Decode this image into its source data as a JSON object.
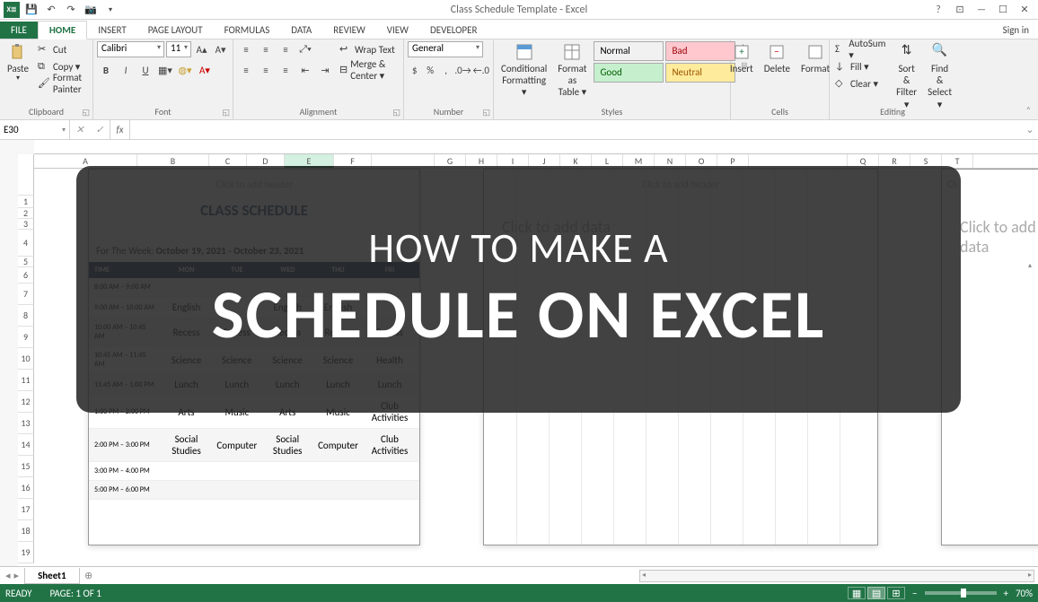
{
  "title": "Class Schedule Template - Excel",
  "qat": {
    "app_icon": "X≣"
  },
  "tabs": [
    "FILE",
    "HOME",
    "INSERT",
    "PAGE LAYOUT",
    "FORMULAS",
    "DATA",
    "REVIEW",
    "VIEW",
    "DEVELOPER"
  ],
  "signin": "Sign in",
  "clipboard": {
    "label": "Clipboard",
    "paste": "Paste",
    "cut": "Cut",
    "copy": "Copy ▾",
    "painter": "Format Painter"
  },
  "font": {
    "label": "Font",
    "name": "Calibri",
    "size": "11",
    "bold": "B",
    "italic": "I",
    "underline": "U"
  },
  "alignment": {
    "label": "Alignment",
    "wrap": "Wrap Text",
    "merge": "Merge & Center ▾"
  },
  "number": {
    "label": "Number",
    "format": "General",
    "dollar": "$",
    "pct": "%",
    "comma": ","
  },
  "stylesg": {
    "label": "Styles",
    "cond": "Conditional Formatting ▾",
    "table": "Format as Table ▾",
    "normal": "Normal",
    "bad": "Bad",
    "good": "Good",
    "neutral": "Neutral"
  },
  "cells": {
    "label": "Cells",
    "insert": "Insert",
    "delete": "Delete",
    "format": "Format"
  },
  "editing": {
    "label": "Editing",
    "autosum": "AutoSum ▾",
    "fill": "Fill ▾",
    "clear": "Clear ▾",
    "sort": "Sort & Filter ▾",
    "find": "Find & Select ▾"
  },
  "namebox": "E30",
  "fx": "fx",
  "columns": [
    {
      "l": "A",
      "w": 115
    },
    {
      "l": "B",
      "w": 80
    },
    {
      "l": "C",
      "w": 42
    },
    {
      "l": "D",
      "w": 42
    },
    {
      "l": "E",
      "w": 55,
      "active": true
    },
    {
      "l": "F",
      "w": 42
    },
    {
      "l": "",
      "w": 70
    },
    {
      "l": "G",
      "w": 35
    },
    {
      "l": "H",
      "w": 35
    },
    {
      "l": "I",
      "w": 35
    },
    {
      "l": "J",
      "w": 35
    },
    {
      "l": "K",
      "w": 35
    },
    {
      "l": "L",
      "w": 35
    },
    {
      "l": "M",
      "w": 35
    },
    {
      "l": "N",
      "w": 35
    },
    {
      "l": "O",
      "w": 35
    },
    {
      "l": "P",
      "w": 35
    },
    {
      "l": "",
      "w": 110
    },
    {
      "l": "Q",
      "w": 35
    },
    {
      "l": "R",
      "w": 35
    },
    {
      "l": "S",
      "w": 35
    },
    {
      "l": "T",
      "w": 35
    }
  ],
  "rows": [
    {
      "n": "",
      "h": 30
    },
    {
      "n": "1",
      "h": 14
    },
    {
      "n": "2",
      "h": 12
    },
    {
      "n": "3",
      "h": 12
    },
    {
      "n": "4",
      "h": 30
    },
    {
      "n": "5",
      "h": 12
    },
    {
      "n": "6",
      "h": 18
    },
    {
      "n": "7",
      "h": 24
    },
    {
      "n": "8",
      "h": 24
    },
    {
      "n": "9",
      "h": 24
    },
    {
      "n": "10",
      "h": 24
    },
    {
      "n": "11",
      "h": 24
    },
    {
      "n": "12",
      "h": 24
    },
    {
      "n": "13",
      "h": 24
    },
    {
      "n": "14",
      "h": 24
    },
    {
      "n": "15",
      "h": 24
    },
    {
      "n": "16",
      "h": 24
    },
    {
      "n": "17",
      "h": 24
    },
    {
      "n": "18",
      "h": 24
    },
    {
      "n": "19",
      "h": 24
    }
  ],
  "schedule": {
    "title": "CLASS SCHEDULE",
    "week_label": "For The Week:",
    "week_value": "October 19, 2021 - October 23, 2021",
    "headers": [
      "TIME",
      "MON",
      "TUE",
      "WED",
      "THU",
      "FRI"
    ],
    "rows": [
      [
        "8:00 AM – 9:00 AM",
        "",
        "",
        "",
        "",
        ""
      ],
      [
        "9:00 AM – 10:00 AM",
        "English",
        "",
        "English",
        "English",
        ""
      ],
      [
        "10:00 AM – 10:45 AM",
        "Recess",
        "Recess",
        "Recess",
        "Recess",
        "Recess"
      ],
      [
        "10:45 AM – 11:45 AM",
        "Science",
        "Science",
        "Science",
        "Science",
        "Health"
      ],
      [
        "11:45 AM – 1:00 PM",
        "Lunch",
        "Lunch",
        "Lunch",
        "Lunch",
        "Lunch"
      ],
      [
        "1:00 PM – 2:00 PM",
        "Arts",
        "Music",
        "Arts",
        "Music",
        "Club Activities"
      ],
      [
        "2:00 PM – 3:00 PM",
        "Social Studies",
        "Computer",
        "Social Studies",
        "Computer",
        "Club Activities"
      ],
      [
        "3:00 PM – 4:00 PM",
        "",
        "",
        "",
        "",
        ""
      ],
      [
        "5:00 PM – 6:00 PM",
        "",
        "",
        "",
        "",
        ""
      ]
    ]
  },
  "add_header": "Click to add header",
  "add_data": "Click to add data",
  "sheet_tab": "Sheet1",
  "status": {
    "ready": "READY",
    "page": "PAGE: 1 OF 1",
    "zoom": "70%"
  },
  "overlay": {
    "line1": "HOW TO MAKE A",
    "line2": "SCHEDULE ON EXCEL"
  }
}
